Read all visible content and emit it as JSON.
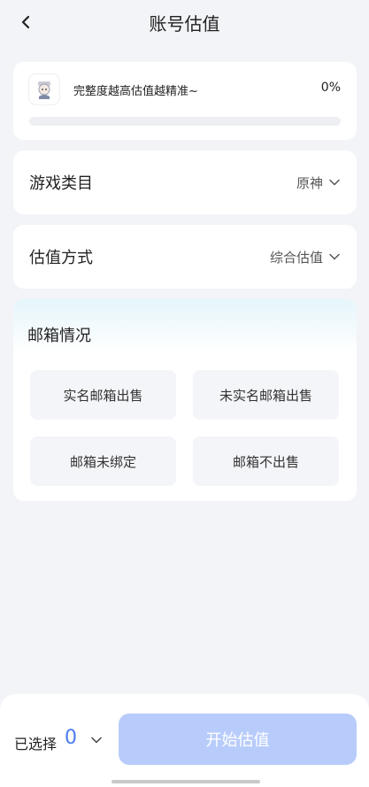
{
  "header": {
    "title": "账号估值"
  },
  "progress": {
    "hint": "完整度越高估值越精准~",
    "percent_label": "0%",
    "percent": 0
  },
  "game_category": {
    "label": "游戏类目",
    "value": "原神"
  },
  "valuation_method": {
    "label": "估值方式",
    "value": "综合估值"
  },
  "mailbox": {
    "title": "邮箱情况",
    "options": [
      "实名邮箱出售",
      "未实名邮箱出售",
      "邮箱未绑定",
      "邮箱不出售"
    ]
  },
  "footer": {
    "selected_label": "已选择",
    "selected_count": "0",
    "start_button": "开始估值"
  },
  "colors": {
    "accent": "#4a7bf0",
    "button_disabled": "#b8ccfb"
  }
}
